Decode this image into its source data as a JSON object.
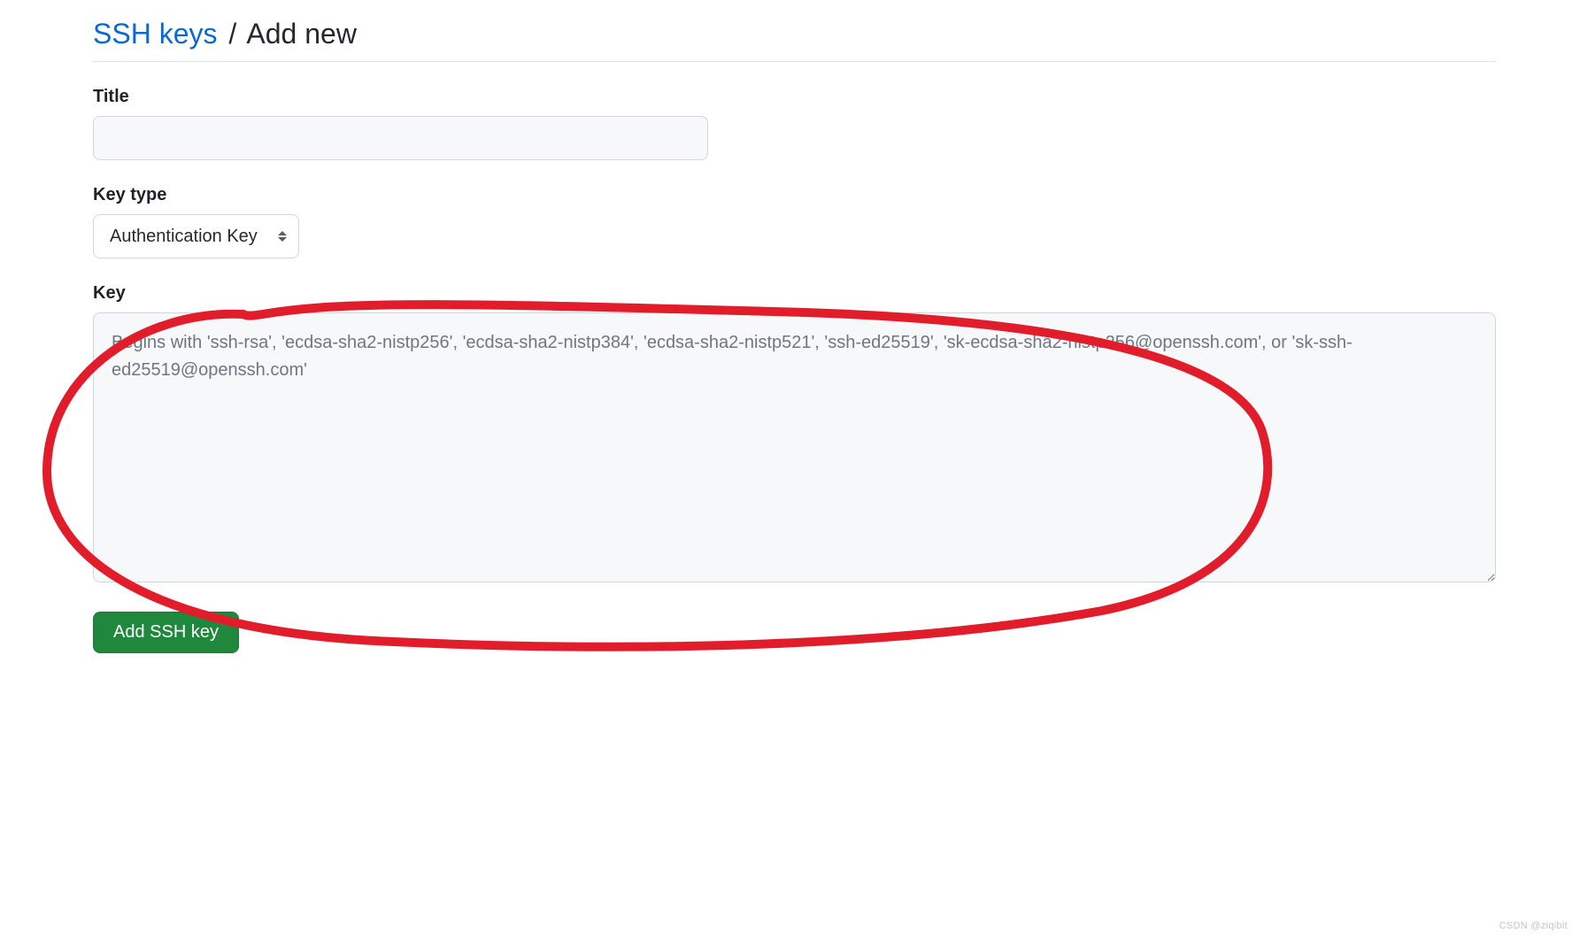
{
  "breadcrumb": {
    "link_label": "SSH keys",
    "separator": "/",
    "current": "Add new"
  },
  "form": {
    "title": {
      "label": "Title",
      "value": ""
    },
    "key_type": {
      "label": "Key type",
      "selected": "Authentication Key"
    },
    "key": {
      "label": "Key",
      "value": "",
      "placeholder": "Begins with 'ssh-rsa', 'ecdsa-sha2-nistp256', 'ecdsa-sha2-nistp384', 'ecdsa-sha2-nistp521', 'ssh-ed25519', 'sk-ecdsa-sha2-nistp256@openssh.com', or 'sk-ssh-ed25519@openssh.com'"
    },
    "submit_label": "Add SSH key"
  },
  "watermark": "CSDN @ziqibit"
}
